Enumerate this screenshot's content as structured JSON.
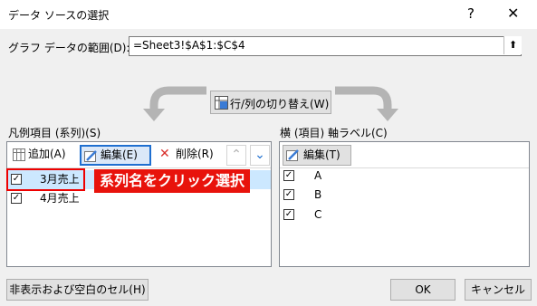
{
  "dialog": {
    "title": "データ ソースの選択",
    "help": "?",
    "close": "✕"
  },
  "range": {
    "label": "グラフ データの範囲(D):",
    "value": "=Sheet3!$A$1:$C$4"
  },
  "switch_button": "行/列の切り替え(W)",
  "legend": {
    "label": "凡例項目 (系列)(S)",
    "add": "追加(A)",
    "edit": "編集(E)",
    "delete": "削除(R)",
    "items": [
      {
        "label": "3月売上",
        "checked": true,
        "selected": true
      },
      {
        "label": "4月売上",
        "checked": true,
        "selected": false
      }
    ]
  },
  "axis": {
    "label": "横 (項目) 軸ラベル(C)",
    "edit": "編集(T)",
    "items": [
      {
        "label": "A",
        "checked": true
      },
      {
        "label": "B",
        "checked": true
      },
      {
        "label": "C",
        "checked": true
      }
    ]
  },
  "callout": "系列名をクリック選択",
  "hidden_cells_button": "非表示および空白のセル(H)",
  "ok": "OK",
  "cancel": "キャンセル",
  "icons": {
    "check": "✓",
    "up": "⌃",
    "down": "⌄",
    "delete_x": "✕",
    "collapse": "⬆"
  },
  "colors": {
    "accent_red": "#e8130c",
    "selected_row": "#cce8ff",
    "delete_red": "#d9302c"
  }
}
